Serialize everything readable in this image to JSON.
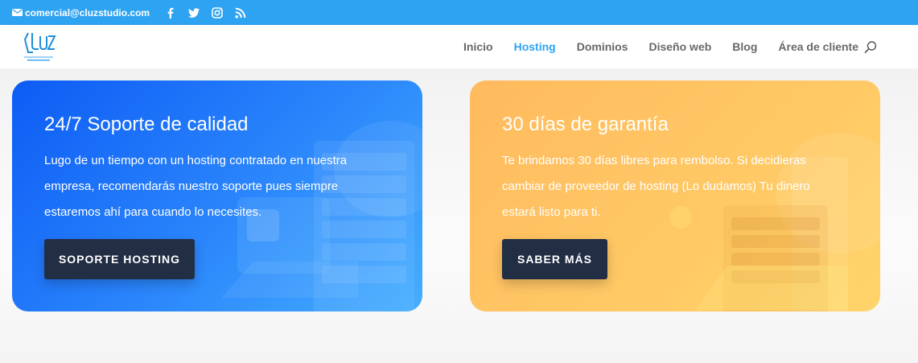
{
  "topbar": {
    "email": "comercial@cluzstudio.com",
    "icons": [
      "mail-icon",
      "facebook-icon",
      "twitter-icon",
      "instagram-icon",
      "rss-icon"
    ]
  },
  "header": {
    "logo_text": "CLUZ STUDIO",
    "nav": [
      {
        "label": "Inicio",
        "active": false
      },
      {
        "label": "Hosting",
        "active": true
      },
      {
        "label": "Dominios",
        "active": false
      },
      {
        "label": "Diseño web",
        "active": false
      },
      {
        "label": "Blog",
        "active": false
      },
      {
        "label": "Área de cliente",
        "active": false
      }
    ],
    "search_icon": "search-icon"
  },
  "cards": {
    "support": {
      "title": "24/7 Soporte de calidad",
      "text": "Lugo de un tiempo con un hosting contratado en nuestra empresa, recomendarás nuestro soporte pues siempre estaremos ahí para cuando lo necesites.",
      "button": "SOPORTE HOSTING",
      "color": "#1a6ff8"
    },
    "guarantee": {
      "title": "30 días de garantía",
      "text": "Te brindamos 30 días libres para rembolso. Si decidieras cambiar de proveedor de hosting (Lo dudamos) Tu dinero estará listo para ti.",
      "button": "SABER MÁS",
      "color": "#ffc463"
    }
  },
  "colors": {
    "topbar": "#2ea3f2",
    "accent": "#2ea3f2",
    "button": "#222e44"
  }
}
